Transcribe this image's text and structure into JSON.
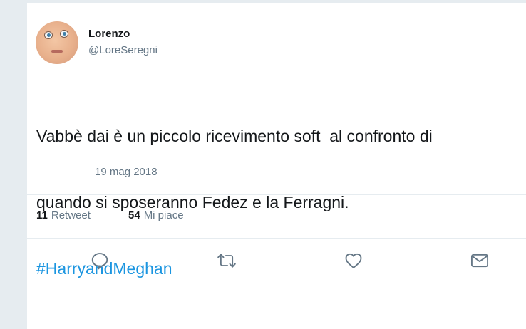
{
  "tweet": {
    "author_name": "Lorenzo",
    "author_handle": "@LoreSeregni",
    "text_line_1": "Vabbè dai è un piccolo ricevimento soft  al confronto di",
    "text_line_2": "quando si sposeranno Fedez e la Ferragni.",
    "hashtag": "#HarryandMeghan",
    "date": "19 mag 2018"
  },
  "stats": {
    "retweets_count": "11",
    "retweets_label": "Retweet",
    "likes_count": "54",
    "likes_label": "Mi piace"
  },
  "actions": {
    "reply_icon": "reply-icon",
    "retweet_icon": "retweet-icon",
    "like_icon": "heart-icon",
    "dm_icon": "envelope-icon"
  },
  "colors": {
    "background": "#e6ecf0",
    "text": "#14171a",
    "secondary": "#657786",
    "hashtag": "#1b95e0"
  }
}
